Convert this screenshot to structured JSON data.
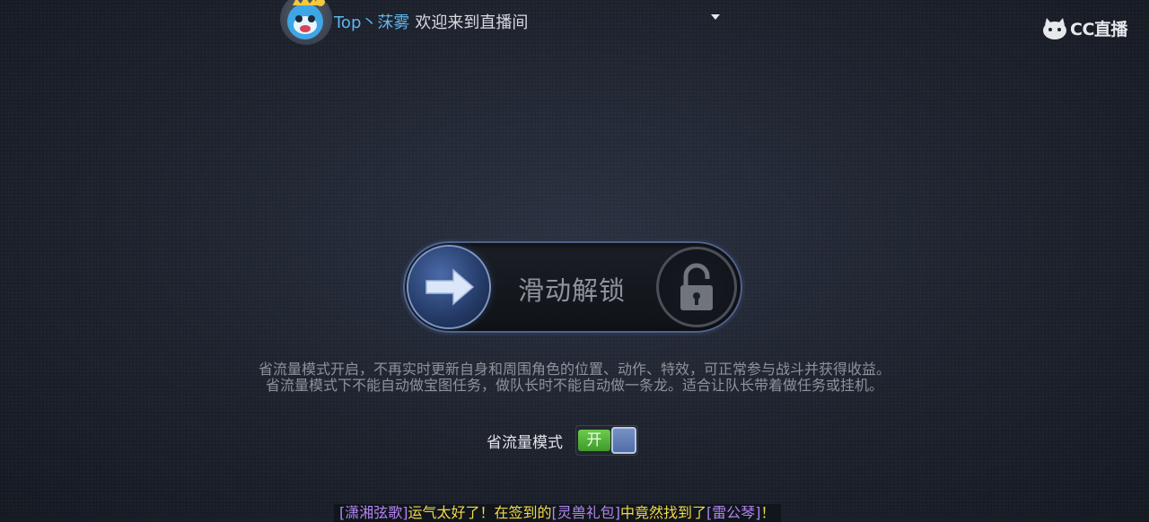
{
  "header": {
    "username": "Top丶莯雾",
    "welcome_text": "欢迎来到直播间",
    "avatar_icon": "cartoon-blue-face-crown-icon",
    "dropdown_icon": "caret-down-icon"
  },
  "brand": {
    "logo_icon": "cc-cat-logo-icon",
    "text": "CC直播"
  },
  "unlock_slider": {
    "label": "滑动解锁",
    "knob_icon": "arrow-right-icon",
    "lock_icon": "unlocked-padlock-icon"
  },
  "description": {
    "line1": "省流量模式开启，不再实时更新自身和周围角色的位置、动作、特效，可正常参与战斗并获得收益。",
    "line2": "省流量模式下不能自动做宝图任务，做队长时不能自动做一条龙。适合让队长带着做任务或挂机。"
  },
  "data_saver": {
    "label": "省流量模式",
    "toggle_text": "开",
    "enabled": true
  },
  "ticker": {
    "player": "[潇湘弦歌]",
    "text1": "运气太好了！在签到的",
    "item1": "[灵兽礼包]",
    "text2": "中竟然找到了",
    "item2": "[雷公琴]",
    "text3": "！"
  },
  "colors": {
    "username": "#5fb6f0",
    "toggle_on": "#4caf32",
    "ticker_name": "#b085f0",
    "ticker_text": "#f0d94a"
  }
}
